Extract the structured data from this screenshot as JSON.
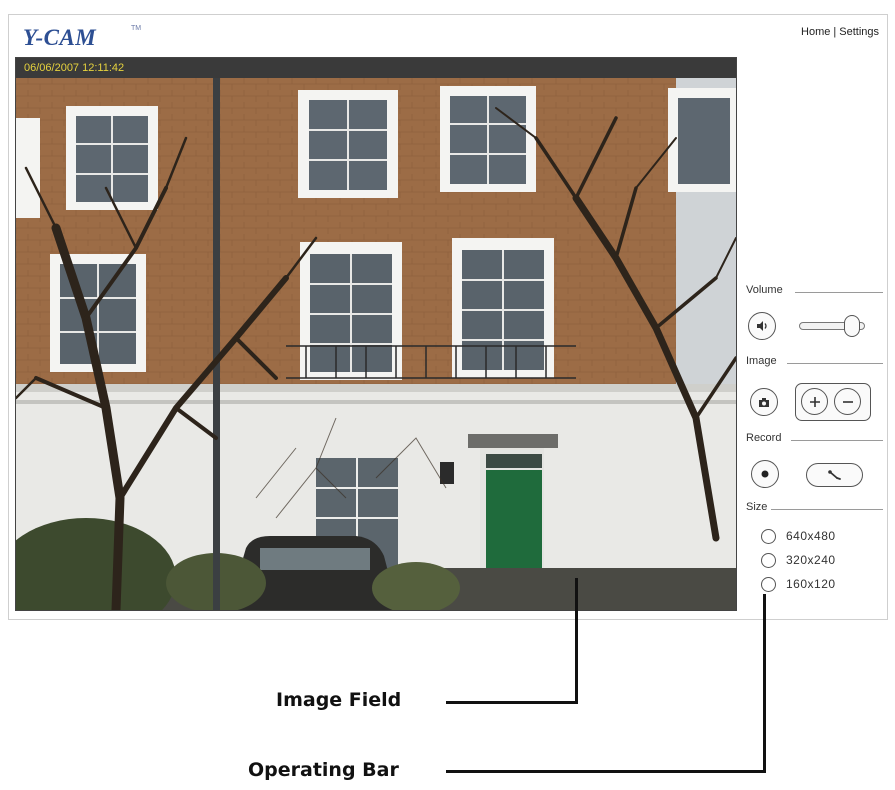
{
  "app": {
    "logo_text": "Y-CAM",
    "logo_mark": "TM",
    "nav": {
      "home": "Home",
      "separator": "|",
      "settings": "Settings"
    }
  },
  "video": {
    "timestamp": "06/06/2007 12:11:42"
  },
  "controls": {
    "volume": {
      "label": "Volume",
      "level": 0.9
    },
    "image": {
      "label": "Image"
    },
    "record": {
      "label": "Record"
    },
    "size": {
      "label": "Size",
      "options": [
        "640x480",
        "320x240",
        "160x120"
      ]
    }
  },
  "annotations": {
    "image_field": "Image Field",
    "operating_bar": "Operating Bar"
  },
  "icons": {
    "speaker": "speaker-icon",
    "snapshot": "camera-icon",
    "zoom_in": "plus-icon",
    "zoom_out": "minus-icon",
    "record": "record-dot-icon",
    "wrench": "wrench-icon"
  },
  "colors": {
    "logo": "#2d4f93",
    "timestamp": "#e6d23e",
    "door": "#1f6b3c"
  }
}
